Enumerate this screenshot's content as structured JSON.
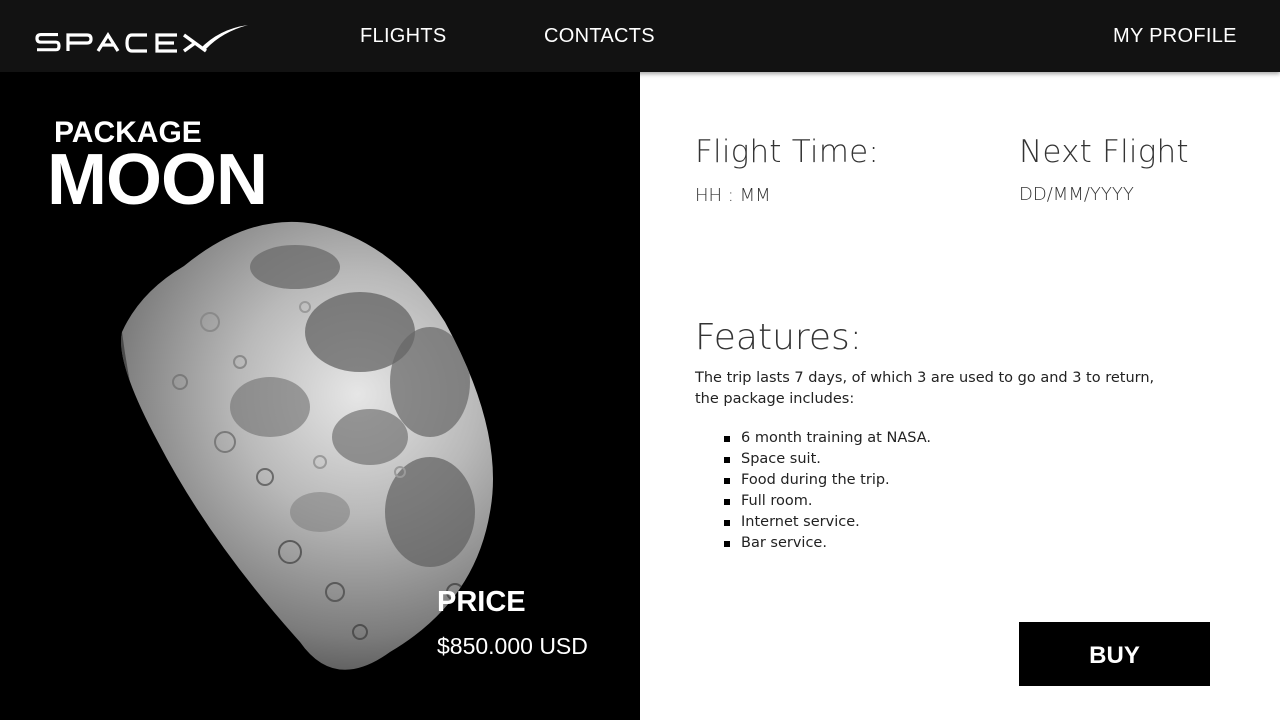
{
  "brand": {
    "logo_text": "SPACEX",
    "logo_icon": "spacex-logo"
  },
  "nav": {
    "flights": "FLIGHTS",
    "contacts": "CONTACTS",
    "profile": "MY PROFILE"
  },
  "package": {
    "label": "PACKAGE",
    "name": "MOON",
    "image_icon": "moon-image",
    "price_label": "PRICE",
    "price_value": "$850.000 USD"
  },
  "details": {
    "flight_time_heading": "Flight Time:",
    "flight_time_value": "HH : MM",
    "next_flight_heading": "Next Flight",
    "next_flight_value": "DD/MM/YYYY"
  },
  "features": {
    "heading": "Features:",
    "description_line1": "The trip lasts 7 days, of which 3 are used to go and 3 to return,",
    "description_line2": "the package includes:",
    "items": [
      "6 month training at NASA.",
      "Space suit.",
      "Food during the trip.",
      "Full room.",
      "Internet service.",
      "Bar service."
    ]
  },
  "actions": {
    "buy_label": "BUY"
  },
  "colors": {
    "navbar_bg": "#121212",
    "left_panel_bg": "#000000",
    "right_panel_bg": "#ffffff",
    "button_bg": "#000000",
    "heading_text": "#333333"
  }
}
